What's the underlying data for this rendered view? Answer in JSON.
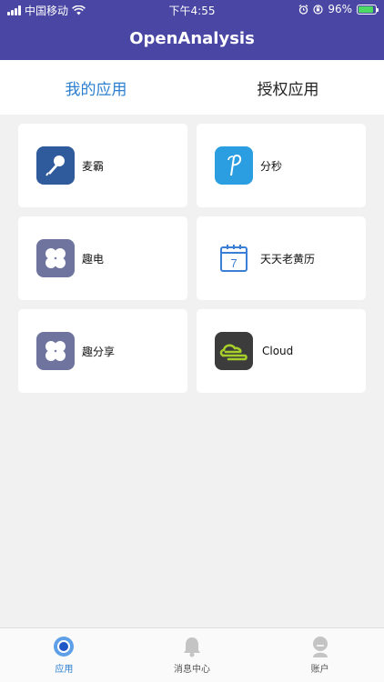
{
  "status_bar": {
    "carrier": "中国移动",
    "time": "下午4:55",
    "battery": "96%"
  },
  "header": {
    "title": "OpenAnalysis"
  },
  "tabs": [
    {
      "label": "我的应用"
    },
    {
      "label": "授权应用"
    }
  ],
  "apps": [
    {
      "name": "麦霸",
      "icon": "microphone-icon"
    },
    {
      "name": "分秒",
      "icon": "fenmiao-p-icon"
    },
    {
      "name": "趣电",
      "icon": "clover-icon"
    },
    {
      "name": "天天老黄历",
      "icon": "calendar-icon",
      "calendar_day": "7"
    },
    {
      "name": "趣分享",
      "icon": "clover-icon"
    },
    {
      "name": "Cloud",
      "icon": "cloud-logo-icon"
    }
  ],
  "bottom_nav": [
    {
      "label": "应用",
      "icon": "app-circle-icon"
    },
    {
      "label": "消息中心",
      "icon": "bell-icon"
    },
    {
      "label": "账户",
      "icon": "user-icon"
    }
  ],
  "colors": {
    "header_bg": "#4a46a3",
    "accent": "#2c7fd0",
    "page_bg": "#f1f1f1"
  }
}
